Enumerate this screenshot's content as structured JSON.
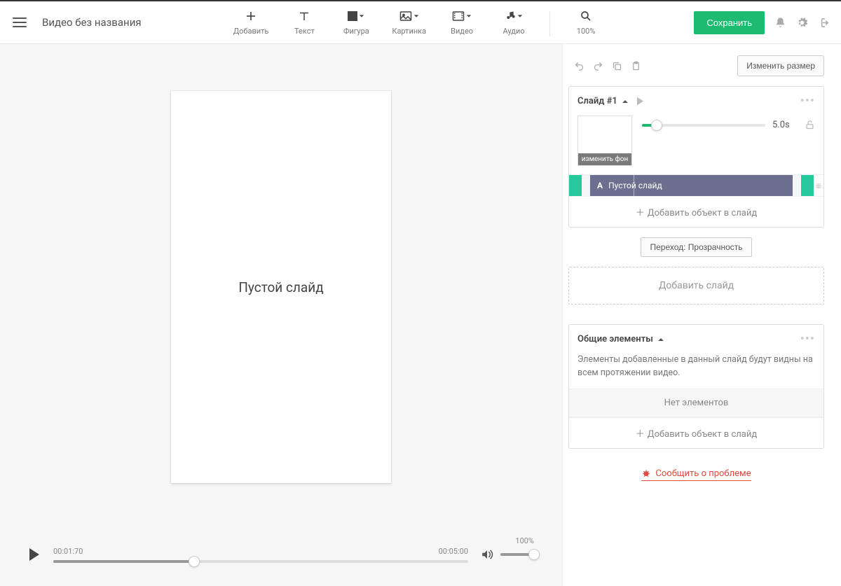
{
  "header": {
    "title": "Видео без названия",
    "tools": {
      "add": "Добавить",
      "text": "Текст",
      "shape": "Фигура",
      "image": "Картинка",
      "video": "Видео",
      "audio": "Аудио"
    },
    "zoom": "100%",
    "save": "Сохранить"
  },
  "canvas": {
    "slide_text": "Пустой слайд"
  },
  "player": {
    "current": "00:01:70",
    "total": "00:05:00",
    "volume": "100%"
  },
  "sidebar": {
    "resize_btn": "Изменить размер",
    "slide": {
      "title": "Слайд #1",
      "thumb_label": "изменить фон",
      "duration": "5.0s",
      "track_label": "Пустой слайд",
      "add_object": "Добавить объект в слайд"
    },
    "transition": "Переход: Прозрачность",
    "add_slide": "Добавить слайд",
    "common": {
      "title": "Общие элементы",
      "desc": "Элементы добавленные в данный слайд будут видны на всем протяжении видео.",
      "empty": "Нет элементов",
      "add_object": "Добавить объект в слайд"
    },
    "report": "Сообщить о проблеме"
  }
}
